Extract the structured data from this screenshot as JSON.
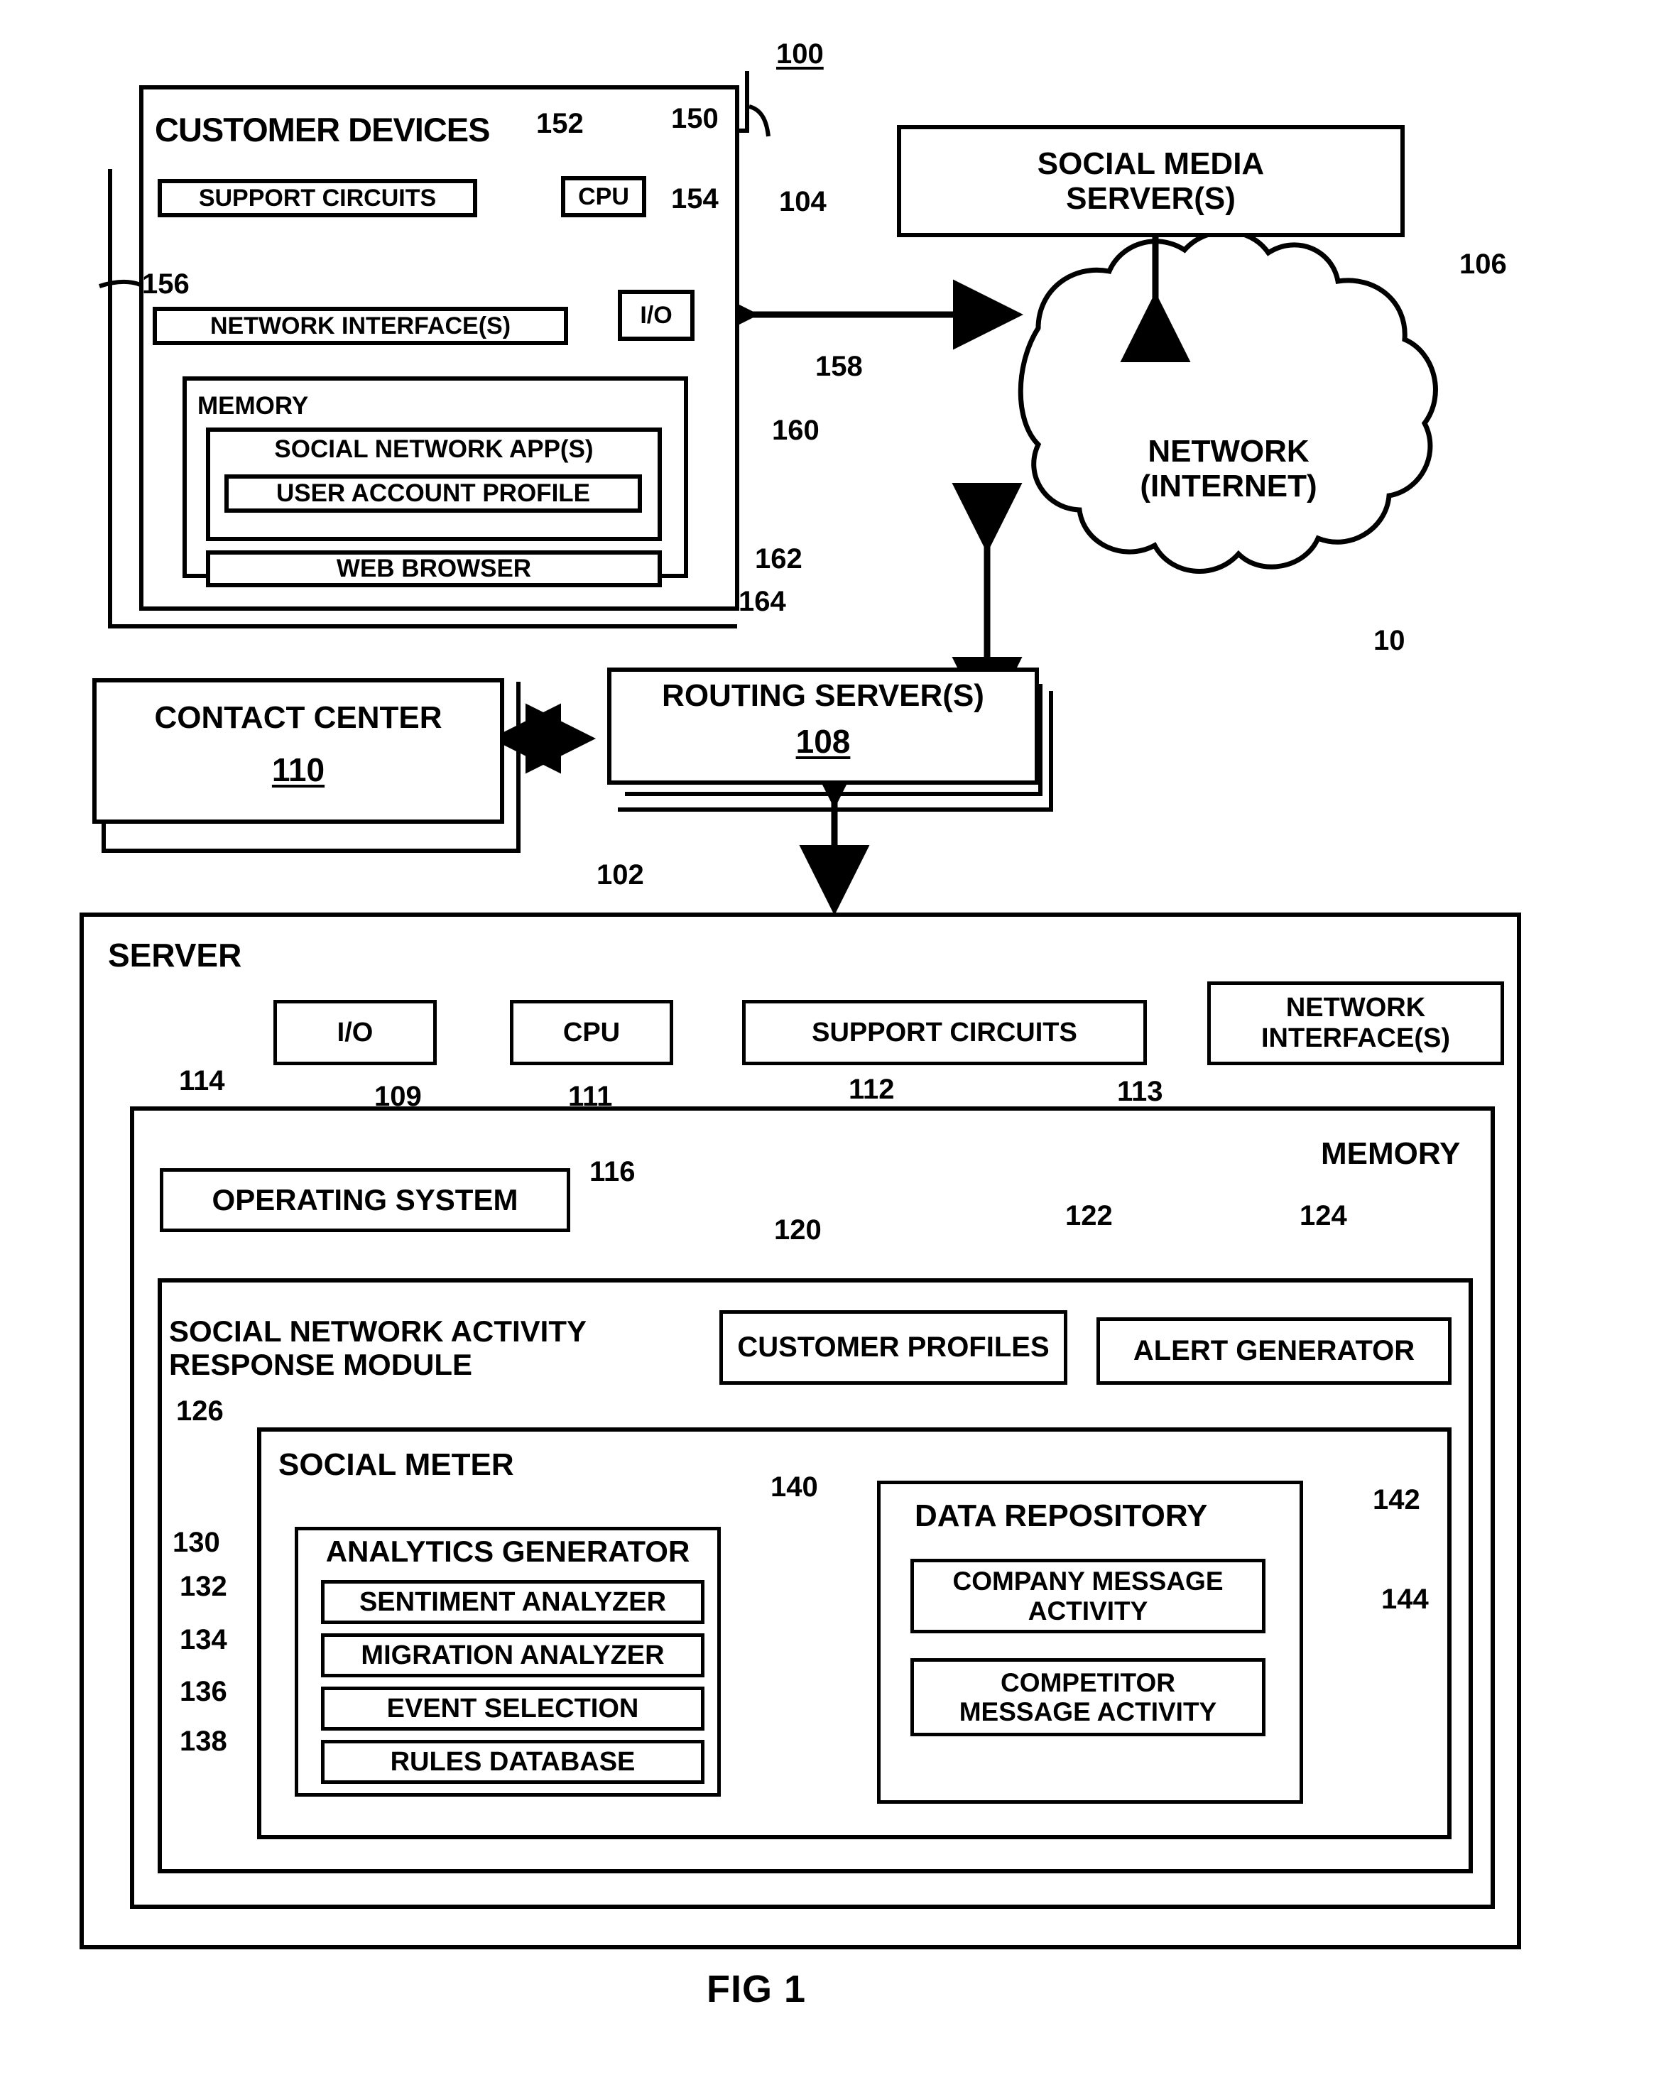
{
  "figure": {
    "caption": "FIG 1",
    "system_ref": "100"
  },
  "customer_devices": {
    "title": "CUSTOMER  DEVICES",
    "ref": "104",
    "support_circuits": {
      "label": "SUPPORT CIRCUITS",
      "ref": "152"
    },
    "cpu": {
      "label": "CPU",
      "ref": "150"
    },
    "io": {
      "label": "I/O",
      "ref": "154"
    },
    "network_interfaces": {
      "label": "NETWORK INTERFACE(S)",
      "ref": "156"
    },
    "memory": {
      "label": "MEMORY",
      "ref": "158",
      "social_network_apps": {
        "label": "SOCIAL NETWORK APP(S)",
        "ref": "160"
      },
      "user_account_profile": {
        "label": "USER ACCOUNT PROFILE",
        "ref": "162"
      },
      "web_browser": {
        "label": "WEB BROWSER",
        "ref": "164"
      }
    }
  },
  "social_media_servers": {
    "label": "SOCIAL MEDIA\nSERVER(S)",
    "ref": "106"
  },
  "network_cloud": {
    "label": "NETWORK\n(INTERNET)",
    "ref": "10"
  },
  "contact_center": {
    "label": "CONTACT CENTER",
    "ref": "110"
  },
  "routing_servers": {
    "label": "ROUTING SERVER(S)",
    "ref": "108"
  },
  "server": {
    "title": "SERVER",
    "ref": "102",
    "io": {
      "label": "I/O",
      "ref": "109"
    },
    "cpu": {
      "label": "CPU",
      "ref": "111"
    },
    "support_circuits": {
      "label": "SUPPORT CIRCUITS",
      "ref": "112"
    },
    "network_interfaces": {
      "label": "NETWORK\nINTERFACE(S)",
      "ref": "113"
    },
    "memory": {
      "label": "MEMORY",
      "ref": "114",
      "operating_system": {
        "label": "OPERATING SYSTEM",
        "ref": "116"
      },
      "response_module": {
        "label": "SOCIAL NETWORK ACTIVITY\nRESPONSE MODULE",
        "ref": "120",
        "customer_profiles": {
          "label": "CUSTOMER PROFILES",
          "ref": "122"
        },
        "alert_generator": {
          "label": "ALERT GENERATOR",
          "ref": "124"
        },
        "social_meter": {
          "label": "SOCIAL METER",
          "ref": "126",
          "analytics_generator": {
            "label": "ANALYTICS GENERATOR",
            "ref": "130",
            "items": [
              {
                "label": "SENTIMENT ANALYZER",
                "ref": "132"
              },
              {
                "label": "MIGRATION ANALYZER",
                "ref": "134"
              },
              {
                "label": "EVENT SELECTION",
                "ref": "136"
              },
              {
                "label": "RULES DATABASE",
                "ref": "138"
              }
            ]
          },
          "data_repository": {
            "label": "DATA REPOSITORY",
            "ref": "140",
            "company_message_activity": {
              "label": "COMPANY MESSAGE\nACTIVITY",
              "ref": "142"
            },
            "competitor_message_activity": {
              "label": "COMPETITOR\nMESSAGE ACTIVITY",
              "ref": "144"
            }
          }
        }
      }
    }
  }
}
